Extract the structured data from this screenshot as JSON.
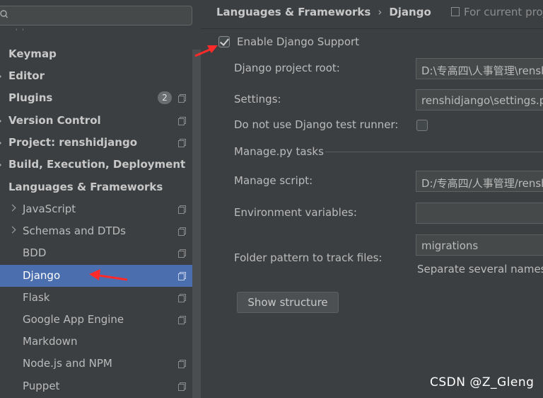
{
  "sidebar": {
    "search": {
      "value": "",
      "placeholder": ""
    },
    "cut_off_item": "' '",
    "items": [
      {
        "label": "Keymap",
        "bold": true
      },
      {
        "label": "Editor",
        "bold": true,
        "expandable": true
      },
      {
        "label": "Plugins",
        "bold": true,
        "badge": "2",
        "project_icon": true
      },
      {
        "label": "Version Control",
        "bold": true,
        "expandable": true,
        "project_icon": true
      },
      {
        "label": "Project: renshidjango",
        "bold": true,
        "expandable": true,
        "project_icon": true
      },
      {
        "label": "Build, Execution, Deployment",
        "bold": true,
        "expandable": true
      },
      {
        "label": "Languages & Frameworks",
        "bold": true,
        "expanded": true
      },
      {
        "label": "JavaScript",
        "child": true,
        "expandable": true,
        "project_icon": true
      },
      {
        "label": "Schemas and DTDs",
        "child": true,
        "expandable": true,
        "project_icon": true
      },
      {
        "label": "BDD",
        "child": true,
        "project_icon": true
      },
      {
        "label": "Django",
        "child": true,
        "selected": true,
        "project_icon": true
      },
      {
        "label": "Flask",
        "child": true,
        "project_icon": true
      },
      {
        "label": "Google App Engine",
        "child": true,
        "project_icon": true
      },
      {
        "label": "Markdown",
        "child": true
      },
      {
        "label": "Node.js and NPM",
        "child": true,
        "project_icon": true
      },
      {
        "label": "Puppet",
        "child": true,
        "project_icon": true
      }
    ]
  },
  "header": {
    "breadcrumb_parent": "Languages & Frameworks",
    "breadcrumb_separator": "›",
    "breadcrumb_current": "Django",
    "scope_text": "For current proj"
  },
  "form": {
    "enable_label": "Enable Django Support",
    "enable_checked": true,
    "project_root_label": "Django project root:",
    "project_root_value": "D:\\专高四\\人事管理\\renshidjango",
    "settings_label": "Settings:",
    "settings_value": "renshidjango\\settings.py",
    "test_runner_label": "Do not use Django test runner:",
    "test_runner_checked": false,
    "manage_tasks_label": "Manage.py tasks",
    "manage_script_label": "Manage script:",
    "manage_script_value": "D:/专高四/人事管理/renshidjango/manage.py",
    "env_vars_label": "Environment variables:",
    "env_vars_value": "",
    "folder_pattern_label": "Folder pattern to track files:",
    "folder_pattern_value": "migrations",
    "folder_pattern_hint": "Separate several names w",
    "show_structure_label": "Show structure"
  },
  "watermark": "CSDN @Z_Gleng",
  "colors": {
    "background": "#3c3f41",
    "selection": "#4b6eaf",
    "annotation_arrow": "#ff2a2a"
  }
}
